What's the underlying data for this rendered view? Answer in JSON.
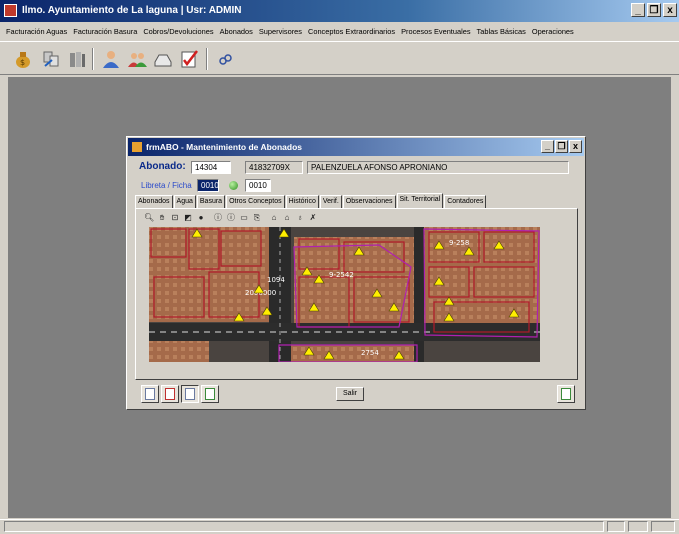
{
  "app": {
    "title": "Ilmo. Ayuntamiento de La laguna | Usr: ADMIN",
    "window_buttons": [
      "_",
      "❐",
      "x"
    ]
  },
  "menu": [
    "Facturación Aguas",
    "Facturación Basura",
    "Cobros/Devoluciones",
    "Abonados",
    "Supervisores",
    "Conceptos Extraordinarios",
    "Procesos Eventuales",
    "Tablas Básicas",
    "Operaciones"
  ],
  "toolbar_icons": [
    "money-bag-icon",
    "transfer-icon",
    "books-icon",
    "user-icon",
    "users-icon",
    "tray-icon",
    "checklist-icon",
    "keys-icon"
  ],
  "dialog": {
    "title": "frmABO - Mantenimiento de Abonados",
    "abonado_label": "Abonado:",
    "abonado_id": "14304",
    "nif": "41832709X",
    "name": "PALENZUELA AFONSO APRONIANO",
    "libreta_label": "Libreta / Ficha",
    "libreta_value": "0010",
    "ficha_value": "0010",
    "tabs": [
      "Abonados",
      "Agua",
      "Basura",
      "Otros Conceptos",
      "Histórico",
      "Verif.",
      "Observaciones",
      "Sit. Territorial",
      "Contadores"
    ],
    "active_tab": "Sit. Territorial",
    "salir_label": "Salir"
  },
  "map": {
    "labels": [
      "1094",
      "2000000",
      "9-2542",
      "2754",
      "9-258"
    ]
  },
  "colors": {
    "titlebar_start": "#0a246a",
    "titlebar_end": "#a6caf0",
    "mdi_background": "#7f7f7f",
    "window_face": "#d4d0c8",
    "parcel_border": "#b01a2a",
    "marker": "#ffee00"
  }
}
